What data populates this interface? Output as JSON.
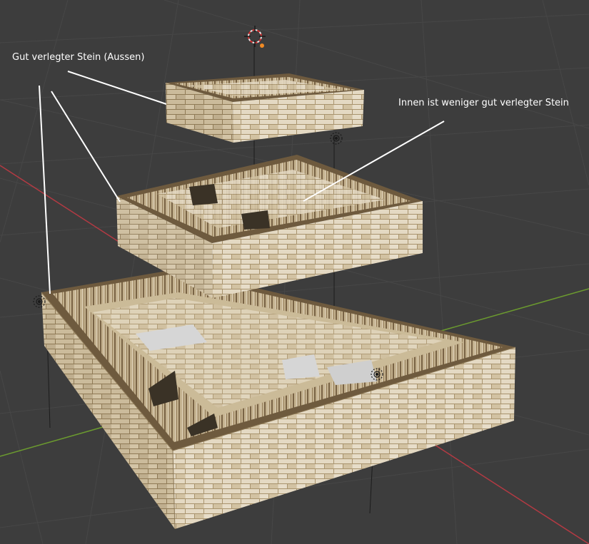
{
  "viewport": {
    "background": "#3d3d3d",
    "grid_color": "#474747",
    "axis_x_color": "#b33a43",
    "axis_y_color": "#6b9a2f",
    "brick_light": "#e2d6bd",
    "brick_mid": "#cbbb98",
    "brick_dark": "#9e8762",
    "mortar": "#bfae8c",
    "wood_light": "#d4c4a2",
    "wood_dark": "#6e5a3e"
  },
  "annotations": {
    "outer_label": "Gut verlegter Stein (Aussen)",
    "inner_label": "Innen ist weniger gut verlegter Stein"
  },
  "icons": {
    "cursor": "3d-cursor-icon",
    "light": "light-object-icon"
  }
}
